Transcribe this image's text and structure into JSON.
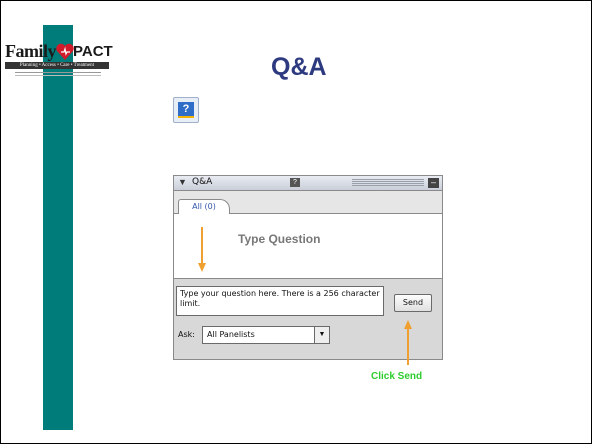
{
  "logo": {
    "word": "Family",
    "brand": "PACT",
    "strip": "Planning • Access • Care • Treatment"
  },
  "slide": {
    "title": "Q&A"
  },
  "help_button": {
    "icon": "question-icon",
    "glyph": "?"
  },
  "qa_panel": {
    "title": "Q&A",
    "collapse_glyph": "▼",
    "help_glyph": "?",
    "minimize_glyph": "–",
    "tab_label": "All (0)",
    "question_text": "Type your question here. There is a 256 character limit.",
    "send_label": "Send",
    "ask_label": "Ask:",
    "ask_selected": "All Panelists",
    "dropdown_glyph": "▼"
  },
  "annotations": {
    "type_question": "Type Question",
    "click_send": "Click Send",
    "arrow_color": "#f0a030",
    "click_send_color": "#2ecc2e"
  },
  "colors": {
    "sidebar": "#007d7b",
    "title": "#2e3a80"
  }
}
